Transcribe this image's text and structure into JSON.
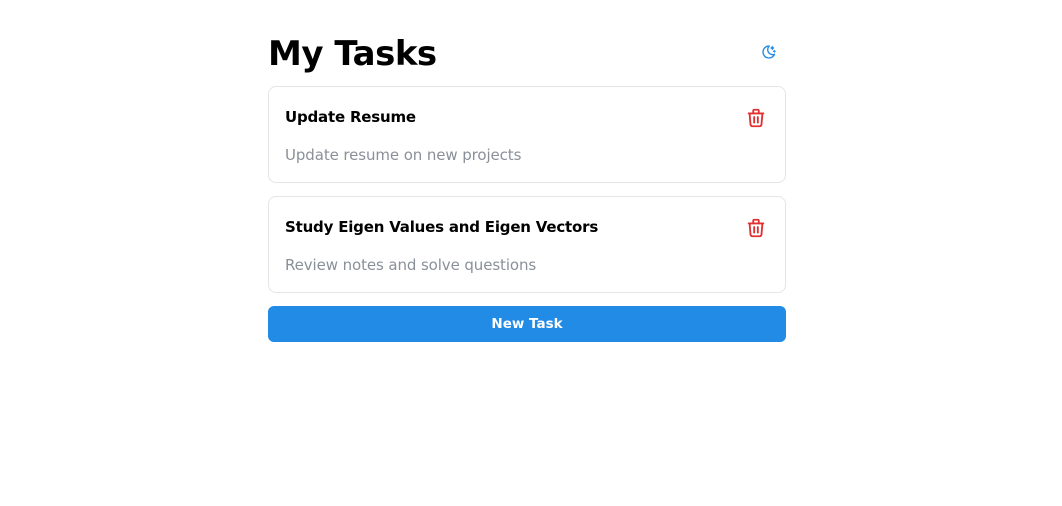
{
  "header": {
    "title": "My Tasks",
    "theme_toggle_icon": "moon-icon"
  },
  "tasks": [
    {
      "title": "Update Resume",
      "description": "Update resume on new projects",
      "delete_icon": "trash-icon"
    },
    {
      "title": "Study Eigen Values and Eigen Vectors",
      "description": "Review notes and solve questions",
      "delete_icon": "trash-icon"
    }
  ],
  "actions": {
    "new_task_label": "New Task"
  },
  "colors": {
    "primary": "#228be6",
    "danger": "#e03131",
    "muted_text": "#8a9099",
    "border": "#e3e5e8"
  }
}
